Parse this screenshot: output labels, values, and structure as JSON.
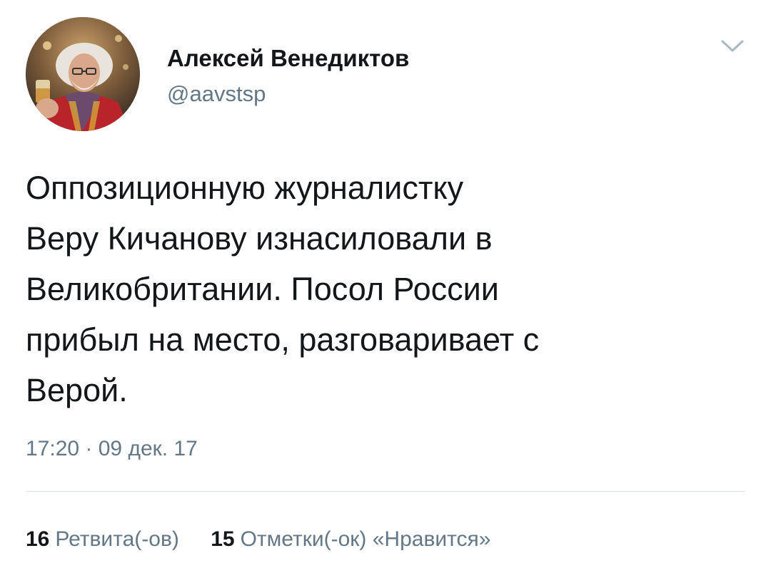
{
  "author": {
    "display_name": "Алексей Венедиктов",
    "handle": "@aavstsp",
    "avatar_icon": "user-avatar-photo"
  },
  "menu": {
    "icon": "chevron-down-icon"
  },
  "tweet": {
    "text": "Оппозиционную журналистку\nВеру Кичанову изнасиловали в\nВеликобритании. Посол России\nприбыл на место, разговаривает с\nВерой.",
    "timestamp": "17:20 · 09 дек. 17"
  },
  "stats": {
    "retweets_count": "16",
    "retweets_label": "Ретвита(-ов)",
    "likes_count": "15",
    "likes_label": "Отметки(-ок) «Нравится»"
  },
  "colors": {
    "text_primary": "#14171a",
    "text_secondary": "#657786",
    "divider": "#e1e8ed",
    "background": "#ffffff"
  }
}
